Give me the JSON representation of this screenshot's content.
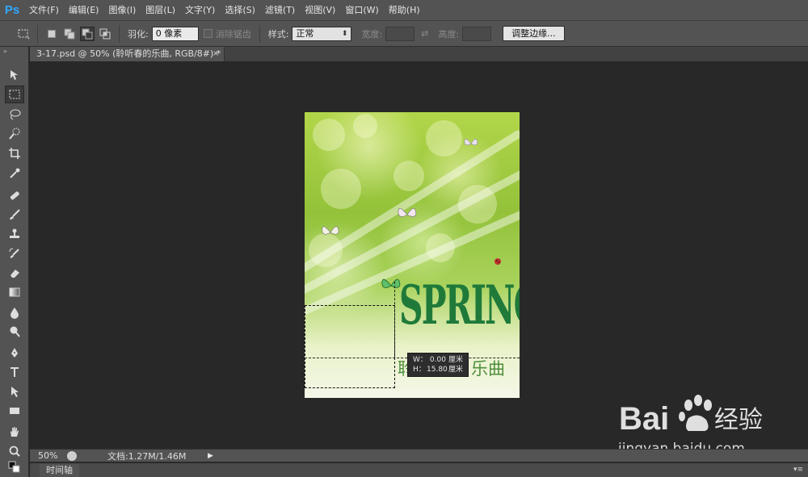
{
  "app": {
    "logo": "Ps",
    "menu": [
      "文件(F)",
      "编辑(E)",
      "图像(I)",
      "图层(L)",
      "文字(Y)",
      "选择(S)",
      "滤镜(T)",
      "视图(V)",
      "窗口(W)",
      "帮助(H)"
    ]
  },
  "options": {
    "feather_label": "羽化:",
    "feather_value": "0 像素",
    "antialias_label": "消除锯齿",
    "style_label": "样式:",
    "style_value": "正常",
    "width_label": "宽度:",
    "height_label": "高度:",
    "refine_edge": "调整边缘..."
  },
  "document": {
    "tab_title": "3-17.psd @ 50% (聆听春的乐曲, RGB/8#) *",
    "close": "×"
  },
  "artwork": {
    "title": "SPRING",
    "subtitle_left": "聆",
    "subtitle_right": "乐曲"
  },
  "tooltip": {
    "w_label": "W：",
    "w_value": "0.00",
    "w_unit": "厘米",
    "h_label": "H：",
    "h_value": "15.80",
    "h_unit": "厘米"
  },
  "status": {
    "zoom": "50%",
    "doc_info": "文档:1.27M/1.46M"
  },
  "timeline": {
    "label": "时间轴"
  },
  "watermark": {
    "brand_left": "Bai",
    "brand_right": "经验",
    "url": "jingyan.baidu.com"
  },
  "colors": {
    "ui_bg": "#535353",
    "canvas_bg": "#282828",
    "title_green": "#1f7a3a",
    "ps_blue": "#31a8ff"
  },
  "icons": {
    "tools": [
      "move-icon",
      "rect-marquee-icon",
      "lasso-icon",
      "quick-select-icon",
      "crop-icon",
      "eyedropper-icon",
      "healing-brush-icon",
      "brush-icon",
      "clone-stamp-icon",
      "history-brush-icon",
      "eraser-icon",
      "gradient-icon",
      "blur-icon",
      "dodge-icon",
      "pen-icon",
      "type-icon",
      "path-select-icon",
      "rectangle-shape-icon",
      "hand-icon",
      "zoom-icon",
      "color-swatches-icon"
    ]
  }
}
